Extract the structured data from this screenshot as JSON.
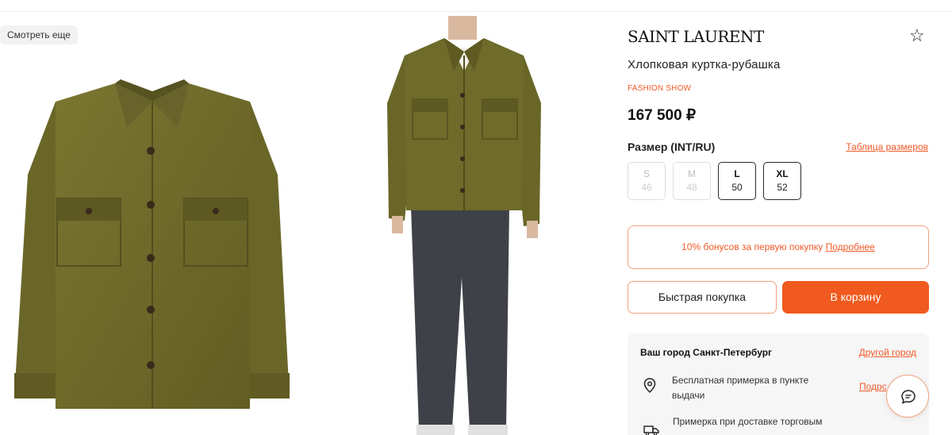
{
  "gallery": {
    "see_more_label": "Смотреть еще"
  },
  "product": {
    "brand": "SAINT LAURENT",
    "title": "Хлопковая куртка-рубашка",
    "tag": "FASHION SHOW",
    "price": "167 500 ₽",
    "favorite_icon": "star-outline-icon"
  },
  "sizes": {
    "label": "Размер (INT/RU)",
    "table_link": "Таблица размеров",
    "options": [
      {
        "int": "S",
        "ru": "46",
        "available": false
      },
      {
        "int": "M",
        "ru": "48",
        "available": false
      },
      {
        "int": "L",
        "ru": "50",
        "available": true
      },
      {
        "int": "XL",
        "ru": "52",
        "available": true
      }
    ]
  },
  "bonus": {
    "text": "10% бонусов за первую покупку",
    "link": "Подробнее"
  },
  "actions": {
    "quick_buy": "Быстрая покупка",
    "add_to_cart": "В корзину"
  },
  "delivery": {
    "city": "Ваш город Санкт-Петербург",
    "other_city_link": "Другой город",
    "option1": "Бесплатная примерка в пункте выдачи",
    "option1_link": "Подробнее",
    "option2": "Примерка при доставке торговым"
  },
  "colors": {
    "accent": "#f05a1e",
    "jacket": "#6f6b2a",
    "jeans": "#3f4148"
  }
}
